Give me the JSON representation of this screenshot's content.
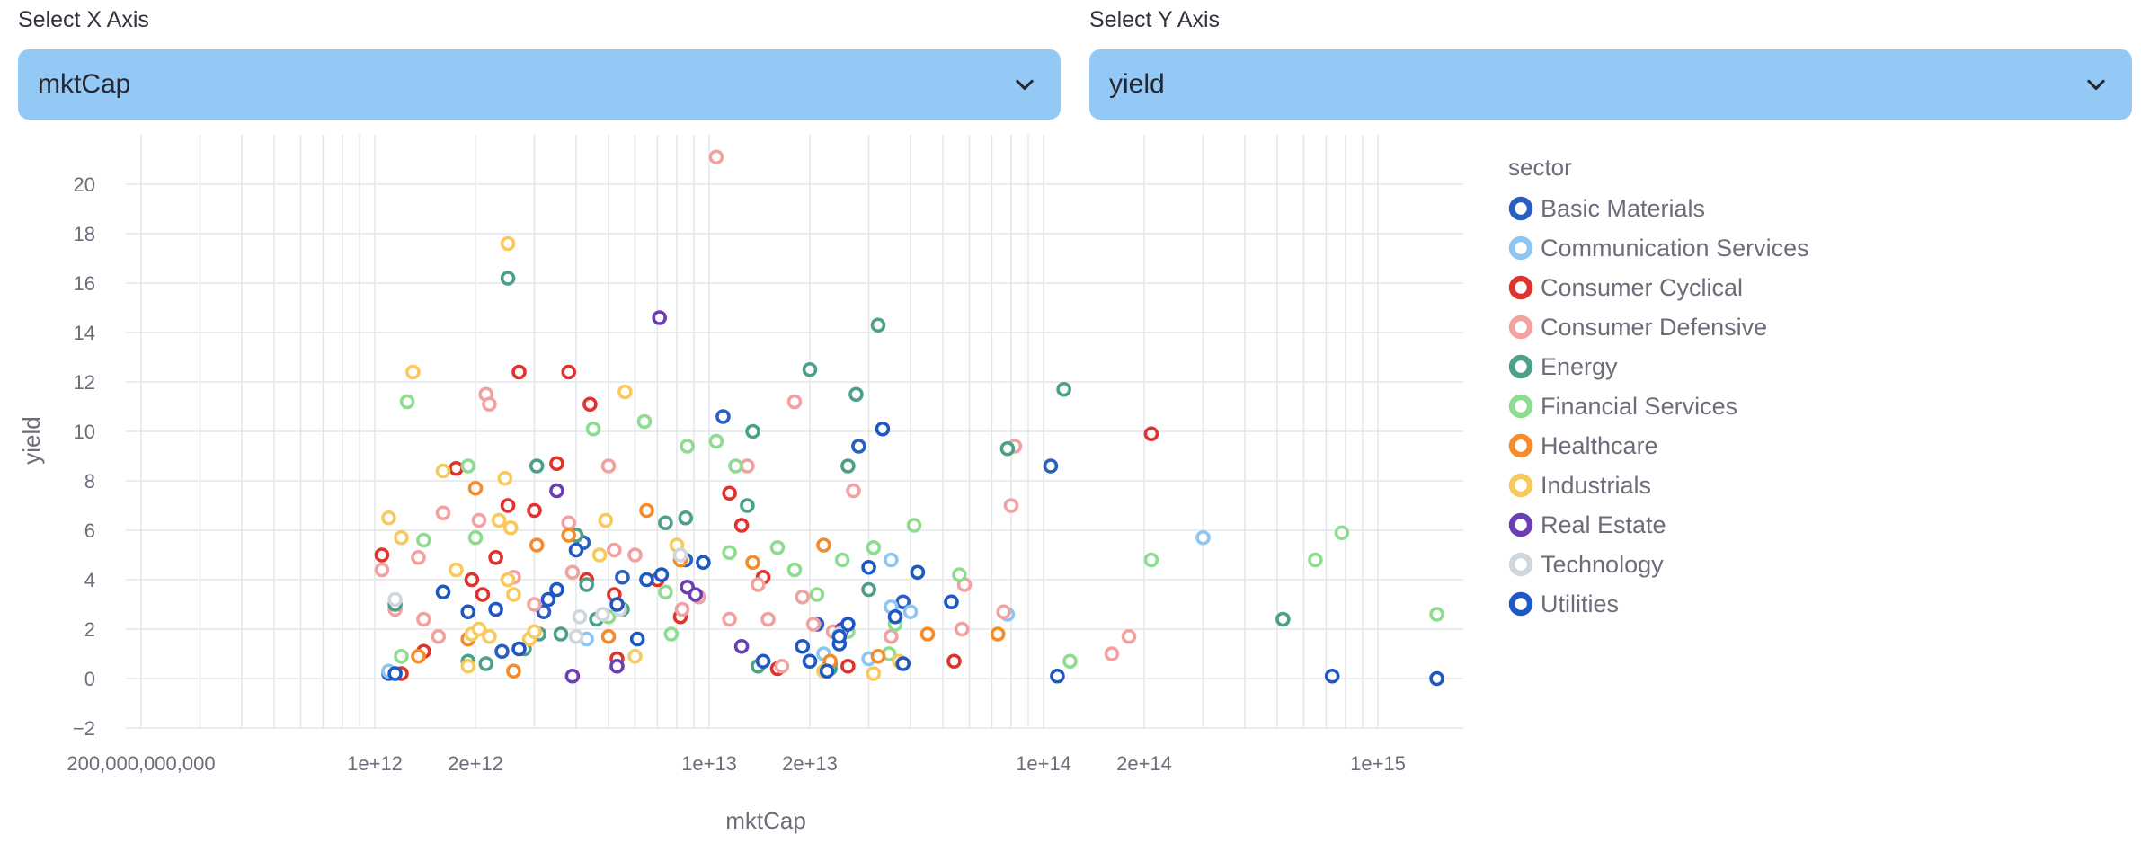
{
  "selectors": {
    "x": {
      "label": "Select X Axis",
      "value": "mktCap"
    },
    "y": {
      "label": "Select Y Axis",
      "value": "yield"
    }
  },
  "legend_title": "sector",
  "chart_data": {
    "type": "scatter",
    "xlabel": "mktCap",
    "ylabel": "yield",
    "x_scale": "log",
    "xlim": [
      180000000000,
      1800000000000000
    ],
    "ylim": [
      -2,
      22
    ],
    "x_ticks": [
      {
        "v": 200000000000,
        "label": "200,000,000,000"
      },
      {
        "v": 1000000000000,
        "label": "1e+12"
      },
      {
        "v": 2000000000000,
        "label": "2e+12"
      },
      {
        "v": 10000000000000,
        "label": "1e+13"
      },
      {
        "v": 20000000000000,
        "label": "2e+13"
      },
      {
        "v": 100000000000000,
        "label": "1e+14"
      },
      {
        "v": 200000000000000,
        "label": "2e+14"
      },
      {
        "v": 1000000000000000,
        "label": "1e+15"
      }
    ],
    "y_ticks": [
      -2,
      0,
      2,
      4,
      6,
      8,
      10,
      12,
      14,
      16,
      18,
      20
    ],
    "grid": true,
    "legend_position": "right",
    "series": [
      {
        "name": "Basic Materials",
        "color": "#2a5fc1",
        "points": [
          [
            1100000000000.0,
            0.2
          ],
          [
            2400000000000.0,
            1.1
          ],
          [
            4200000000000.0,
            5.5
          ],
          [
            5500000000000.0,
            4.1
          ],
          [
            8500000000000.0,
            4.8
          ],
          [
            11000000000000.0,
            10.6
          ],
          [
            21000000000000.0,
            2.2
          ],
          [
            28000000000000.0,
            9.4
          ],
          [
            38000000000000.0,
            3.1
          ],
          [
            105000000000000.0,
            8.6
          ],
          [
            3200000000000.0,
            2.7
          ]
        ]
      },
      {
        "name": "Communication Services",
        "color": "#8ec6f3",
        "points": [
          [
            1100000000000.0,
            0.3
          ],
          [
            4300000000000.0,
            1.6
          ],
          [
            22000000000000.0,
            1.0
          ],
          [
            30000000000000.0,
            0.8
          ],
          [
            35000000000000.0,
            2.9
          ],
          [
            40000000000000.0,
            2.7
          ],
          [
            78000000000000.0,
            2.6
          ],
          [
            35000000000000.0,
            4.8
          ],
          [
            300000000000000.0,
            5.7
          ]
        ]
      },
      {
        "name": "Consumer Cyclical",
        "color": "#e0332e",
        "points": [
          [
            1050000000000.0,
            5.0
          ],
          [
            1200000000000.0,
            0.2
          ],
          [
            1400000000000.0,
            1.1
          ],
          [
            1750000000000.0,
            8.5
          ],
          [
            1900000000000.0,
            1.6
          ],
          [
            1950000000000.0,
            4.0
          ],
          [
            2100000000000.0,
            3.4
          ],
          [
            2300000000000.0,
            4.9
          ],
          [
            2500000000000.0,
            7.0
          ],
          [
            2700000000000.0,
            12.4
          ],
          [
            3000000000000.0,
            6.8
          ],
          [
            3500000000000.0,
            8.7
          ],
          [
            3800000000000.0,
            12.4
          ],
          [
            4000000000000.0,
            5.8
          ],
          [
            4300000000000.0,
            4.0
          ],
          [
            4400000000000.0,
            11.1
          ],
          [
            5200000000000.0,
            3.4
          ],
          [
            5300000000000.0,
            0.8
          ],
          [
            7000000000000.0,
            4.0
          ],
          [
            8200000000000.0,
            2.5
          ],
          [
            11500000000000.0,
            7.5
          ],
          [
            12500000000000.0,
            6.2
          ],
          [
            14500000000000.0,
            4.1
          ],
          [
            16000000000000.0,
            0.4
          ],
          [
            23000000000000.0,
            0.6
          ],
          [
            26000000000000.0,
            0.5
          ],
          [
            54000000000000.0,
            0.7
          ],
          [
            210000000000000.0,
            9.9
          ]
        ]
      },
      {
        "name": "Consumer Defensive",
        "color": "#f2a1a0",
        "points": [
          [
            1050000000000.0,
            4.4
          ],
          [
            1150000000000.0,
            2.8
          ],
          [
            1350000000000.0,
            4.9
          ],
          [
            1400000000000.0,
            2.4
          ],
          [
            1550000000000.0,
            1.7
          ],
          [
            1600000000000.0,
            6.7
          ],
          [
            2050000000000.0,
            6.4
          ],
          [
            2150000000000.0,
            11.5
          ],
          [
            2200000000000.0,
            11.1
          ],
          [
            2600000000000.0,
            4.1
          ],
          [
            3000000000000.0,
            3.0
          ],
          [
            3800000000000.0,
            6.3
          ],
          [
            3900000000000.0,
            4.3
          ],
          [
            5000000000000.0,
            8.6
          ],
          [
            5200000000000.0,
            5.2
          ],
          [
            6000000000000.0,
            5.0
          ],
          [
            8300000000000.0,
            2.8
          ],
          [
            9300000000000.0,
            3.3
          ],
          [
            10500000000000.0,
            21.1
          ],
          [
            11500000000000.0,
            2.4
          ],
          [
            13000000000000.0,
            8.6
          ],
          [
            15000000000000.0,
            2.4
          ],
          [
            16500000000000.0,
            0.5
          ],
          [
            18000000000000.0,
            11.2
          ],
          [
            19000000000000.0,
            3.3
          ],
          [
            20500000000000.0,
            2.2
          ],
          [
            23500000000000.0,
            1.9
          ],
          [
            27000000000000.0,
            7.6
          ],
          [
            35000000000000.0,
            1.7
          ],
          [
            57000000000000.0,
            2.0
          ],
          [
            58000000000000.0,
            3.8
          ],
          [
            76000000000000.0,
            2.7
          ],
          [
            80000000000000.0,
            7.0
          ],
          [
            82000000000000.0,
            9.4
          ],
          [
            160000000000000.0,
            1.0
          ],
          [
            180000000000000.0,
            1.7
          ],
          [
            14000000000000.0,
            3.8
          ]
        ]
      },
      {
        "name": "Energy",
        "color": "#4ca08a",
        "points": [
          [
            1150000000000.0,
            3.0
          ],
          [
            1900000000000.0,
            0.7
          ],
          [
            2150000000000.0,
            0.6
          ],
          [
            2500000000000.0,
            16.2
          ],
          [
            2800000000000.0,
            1.2
          ],
          [
            3050000000000.0,
            8.6
          ],
          [
            3100000000000.0,
            1.8
          ],
          [
            3600000000000.0,
            1.8
          ],
          [
            4000000000000.0,
            5.8
          ],
          [
            4300000000000.0,
            3.8
          ],
          [
            4600000000000.0,
            2.4
          ],
          [
            5500000000000.0,
            2.8
          ],
          [
            7400000000000.0,
            6.3
          ],
          [
            8500000000000.0,
            6.5
          ],
          [
            13000000000000.0,
            7.0
          ],
          [
            13500000000000.0,
            10.0
          ],
          [
            14000000000000.0,
            0.5
          ],
          [
            20000000000000.0,
            12.5
          ],
          [
            23000000000000.0,
            0.4
          ],
          [
            26000000000000.0,
            8.6
          ],
          [
            27500000000000.0,
            11.5
          ],
          [
            30000000000000.0,
            3.6
          ],
          [
            32000000000000.0,
            14.3
          ],
          [
            78000000000000.0,
            9.3
          ],
          [
            115000000000000.0,
            11.7
          ],
          [
            520000000000000.0,
            2.4
          ]
        ]
      },
      {
        "name": "Financial Services",
        "color": "#8ddc8f",
        "points": [
          [
            1200000000000.0,
            0.9
          ],
          [
            1250000000000.0,
            11.2
          ],
          [
            1400000000000.0,
            5.6
          ],
          [
            1900000000000.0,
            8.6
          ],
          [
            2000000000000.0,
            5.7
          ],
          [
            4500000000000.0,
            10.1
          ],
          [
            5000000000000.0,
            2.5
          ],
          [
            6400000000000.0,
            10.4
          ],
          [
            7400000000000.0,
            3.5
          ],
          [
            7700000000000.0,
            1.8
          ],
          [
            8600000000000.0,
            9.4
          ],
          [
            10500000000000.0,
            9.6
          ],
          [
            11500000000000.0,
            5.1
          ],
          [
            12000000000000.0,
            8.6
          ],
          [
            16000000000000.0,
            5.3
          ],
          [
            18000000000000.0,
            4.4
          ],
          [
            21000000000000.0,
            3.4
          ],
          [
            25000000000000.0,
            4.8
          ],
          [
            26000000000000.0,
            1.9
          ],
          [
            31000000000000.0,
            5.3
          ],
          [
            34500000000000.0,
            1.0
          ],
          [
            36000000000000.0,
            2.2
          ],
          [
            41000000000000.0,
            6.2
          ],
          [
            56000000000000.0,
            4.2
          ],
          [
            120000000000000.0,
            0.7
          ],
          [
            210000000000000.0,
            4.8
          ],
          [
            650000000000000.0,
            4.8
          ],
          [
            780000000000000.0,
            5.9
          ],
          [
            1500000000000000.0,
            2.6
          ]
        ]
      },
      {
        "name": "Healthcare",
        "color": "#f48c2c",
        "points": [
          [
            1350000000000.0,
            0.9
          ],
          [
            1900000000000.0,
            1.6
          ],
          [
            2000000000000.0,
            7.7
          ],
          [
            2600000000000.0,
            0.3
          ],
          [
            3050000000000.0,
            5.4
          ],
          [
            3800000000000.0,
            5.8
          ],
          [
            5000000000000.0,
            1.7
          ],
          [
            6500000000000.0,
            6.8
          ],
          [
            8200000000000.0,
            4.8
          ],
          [
            13500000000000.0,
            4.7
          ],
          [
            22000000000000.0,
            5.4
          ],
          [
            23000000000000.0,
            0.7
          ],
          [
            32000000000000.0,
            0.9
          ],
          [
            45000000000000.0,
            1.8
          ],
          [
            73000000000000.0,
            1.8
          ]
        ]
      },
      {
        "name": "Industrials",
        "color": "#f8c95b",
        "points": [
          [
            1100000000000.0,
            6.5
          ],
          [
            1200000000000.0,
            5.7
          ],
          [
            1300000000000.0,
            12.4
          ],
          [
            1600000000000.0,
            8.4
          ],
          [
            1750000000000.0,
            4.4
          ],
          [
            1900000000000.0,
            0.5
          ],
          [
            1950000000000.0,
            1.8
          ],
          [
            2050000000000.0,
            2.0
          ],
          [
            2200000000000.0,
            1.7
          ],
          [
            2350000000000.0,
            6.4
          ],
          [
            2450000000000.0,
            8.1
          ],
          [
            2500000000000.0,
            17.6
          ],
          [
            2550000000000.0,
            6.1
          ],
          [
            2600000000000.0,
            3.4
          ],
          [
            2900000000000.0,
            1.6
          ],
          [
            3000000000000.0,
            1.9
          ],
          [
            4700000000000.0,
            5.0
          ],
          [
            4900000000000.0,
            6.4
          ],
          [
            5600000000000.0,
            11.6
          ],
          [
            6000000000000.0,
            0.9
          ],
          [
            8000000000000.0,
            5.4
          ],
          [
            22000000000000.0,
            0.3
          ],
          [
            31000000000000.0,
            0.2
          ],
          [
            37000000000000.0,
            0.7
          ],
          [
            2500000000000.0,
            4.0
          ]
        ]
      },
      {
        "name": "Real Estate",
        "color": "#6a3fb6",
        "points": [
          [
            3500000000000.0,
            7.6
          ],
          [
            3900000000000.0,
            0.1
          ],
          [
            5300000000000.0,
            0.5
          ],
          [
            7100000000000.0,
            14.6
          ],
          [
            8600000000000.0,
            3.7
          ],
          [
            9100000000000.0,
            3.4
          ],
          [
            12500000000000.0,
            1.3
          ],
          [
            25000000000000.0,
            2.0
          ]
        ]
      },
      {
        "name": "Technology",
        "color": "#cfd6de",
        "points": [
          [
            1150000000000.0,
            3.2
          ],
          [
            4000000000000.0,
            1.7
          ],
          [
            4100000000000.0,
            2.5
          ],
          [
            4800000000000.0,
            2.6
          ],
          [
            5400000000000.0,
            2.8
          ],
          [
            8200000000000.0,
            5.0
          ],
          [
            24500000000000.0,
            1.8
          ]
        ]
      },
      {
        "name": "Utilities",
        "color": "#1e58c4",
        "points": [
          [
            1150000000000.0,
            0.2
          ],
          [
            1600000000000.0,
            3.5
          ],
          [
            1900000000000.0,
            2.7
          ],
          [
            2300000000000.0,
            2.8
          ],
          [
            2700000000000.0,
            1.2
          ],
          [
            3300000000000.0,
            3.2
          ],
          [
            3500000000000.0,
            3.6
          ],
          [
            4000000000000.0,
            5.2
          ],
          [
            5300000000000.0,
            3.0
          ],
          [
            6100000000000.0,
            1.6
          ],
          [
            6500000000000.0,
            4.0
          ],
          [
            7200000000000.0,
            4.2
          ],
          [
            9600000000000.0,
            4.7
          ],
          [
            14500000000000.0,
            0.7
          ],
          [
            19000000000000.0,
            1.3
          ],
          [
            22500000000000.0,
            0.3
          ],
          [
            24500000000000.0,
            1.4
          ],
          [
            26000000000000.0,
            2.2
          ],
          [
            30000000000000.0,
            4.5
          ],
          [
            33000000000000.0,
            10.1
          ],
          [
            36000000000000.0,
            2.5
          ],
          [
            38000000000000.0,
            0.6
          ],
          [
            42000000000000.0,
            4.3
          ],
          [
            53000000000000.0,
            3.1
          ],
          [
            110000000000000.0,
            0.1
          ],
          [
            730000000000000.0,
            0.1
          ],
          [
            1500000000000000.0,
            0.0
          ],
          [
            24500000000000.0,
            1.7
          ],
          [
            20000000000000.0,
            0.7
          ]
        ]
      }
    ]
  }
}
